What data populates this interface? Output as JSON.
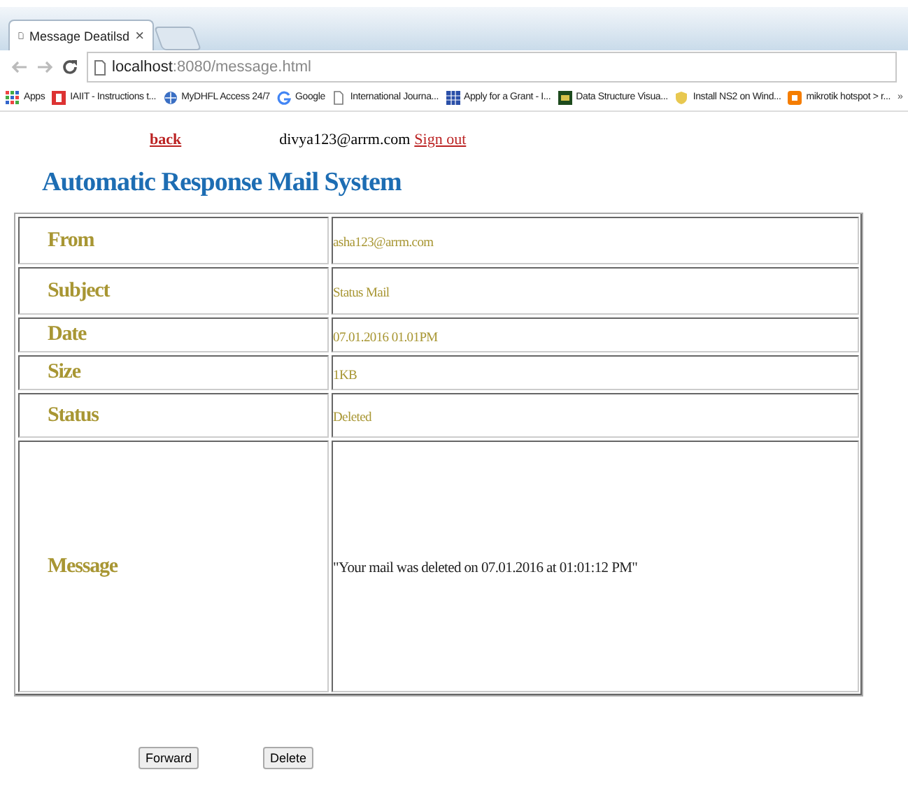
{
  "browser": {
    "tab": {
      "title": "Message Deatilsd",
      "close": "×"
    },
    "address": {
      "host": "localhost",
      "rest": ":8080/message.html"
    },
    "bookmarks": [
      {
        "kind": "apps",
        "label": "Apps"
      },
      {
        "kind": "pdf",
        "label": "IAIIT - Instructions t..."
      },
      {
        "kind": "globe",
        "label": "MyDHFL Access 24/7"
      },
      {
        "kind": "google",
        "label": "Google"
      },
      {
        "kind": "page",
        "label": "International Journa..."
      },
      {
        "kind": "grid",
        "label": "Apply for a Grant - I..."
      },
      {
        "kind": "dsv",
        "label": "Data Structure Visua..."
      },
      {
        "kind": "shield",
        "label": "Install NS2 on Wind..."
      },
      {
        "kind": "blogger",
        "label": "mikrotik hotspot > r..."
      }
    ],
    "more": "»"
  },
  "page": {
    "back": "back",
    "user": "divya123@arrm.com",
    "sign_out": "Sign out",
    "title": "Automatic Response Mail System",
    "rows": [
      {
        "label": "From",
        "value": "asha123@arrm.com"
      },
      {
        "label": "Subject",
        "value": "Status Mail"
      },
      {
        "label": "Date",
        "value": "07.01.2016 01.01PM"
      },
      {
        "label": "Size",
        "value": "1KB"
      },
      {
        "label": "Status",
        "value": "Deleted"
      },
      {
        "label": "Message",
        "value": "\"Your mail was deleted on 07.01.2016 at 01:01:12 PM\""
      }
    ],
    "buttons": [
      "Forward",
      "Delete"
    ]
  }
}
